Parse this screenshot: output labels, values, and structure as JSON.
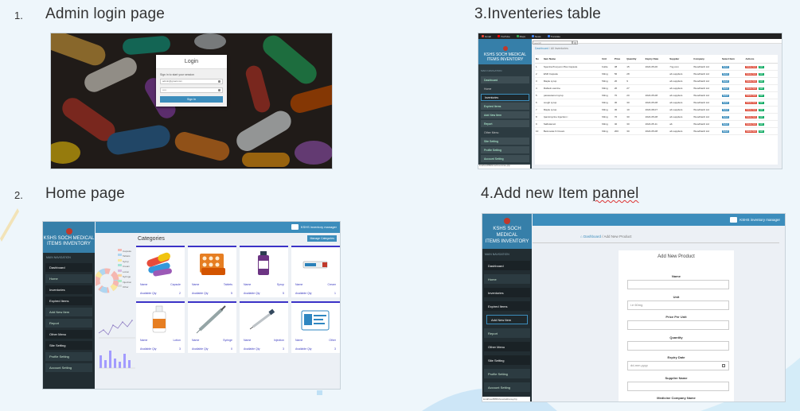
{
  "sections": {
    "login": {
      "num": "1.",
      "title": "Admin login page"
    },
    "inventory": {
      "title": "3.Inventeries table"
    },
    "home": {
      "num": "2.",
      "title": "Home page"
    },
    "add_item": {
      "title_prefix": "4.Add new Item ",
      "title_misspelled": "pannel"
    }
  },
  "login_screen": {
    "header": "Login",
    "hint": "Sign in to start your session",
    "email_value": "admin@gmail.com",
    "password_value": "•••••",
    "submit_label": "Sign In"
  },
  "inventory_screen": {
    "bookmarks": [
      "Gmail",
      "YouTube",
      "Maps",
      "News",
      "Translate"
    ],
    "search_placeholder": "search",
    "search_button": "Q",
    "app_name_line1": "KSHS SOCH MEDICAL",
    "app_name_line2": "ITEMS INVENTORY",
    "nav_header": "MAIN NAVIGATION",
    "nav": [
      "Dashboard",
      "Home",
      "Inventories",
      "Expired Items",
      "Add New Item",
      "Report",
      "Other Menu",
      "Site Setting",
      "Profile Setting",
      "Account Setting"
    ],
    "breadcrumb_root": "Dashboard",
    "breadcrumb_current": "All Inventories",
    "columns": [
      "No",
      "Item Name",
      "Unit",
      "Price",
      "Quantity",
      "Expiry Date",
      "Supplier",
      "Company",
      "Select Item",
      "Actions"
    ],
    "rows": [
      [
        "1",
        "Spectra-Proxyvon Plus Capsule",
        "bottle",
        "38",
        "15",
        "2024-05-00",
        "7ng.com",
        "Woodhardt Ltd"
      ],
      [
        "2",
        "ESR Capsule",
        "60mg",
        "56",
        "28",
        "",
        "ab suppliers",
        "Woodhardt Ltd"
      ],
      [
        "3",
        "Maple syrup",
        "50mg",
        "20",
        "9",
        "",
        "ab suppliers",
        "Woodhardt Ltd"
      ],
      [
        "4",
        "Rabiels vaccine",
        "60mg",
        "20",
        "27",
        "",
        "ab suppliers",
        "Woodhardt Ltd"
      ],
      [
        "5",
        "paracetamol syrup",
        "60mg",
        "70",
        "20",
        "2024-05-08",
        "ab suppliers",
        "Woodhardt Ltd"
      ],
      [
        "6",
        "cough syrup",
        "60mg",
        "30",
        "30",
        "2024-05-08",
        "ab suppliers",
        "Woodhardt Ltd"
      ],
      [
        "7",
        "Maple syrup",
        "60mg",
        "30",
        "10",
        "2024-08-07",
        "ab suppliers",
        "Woodhardt Ltd"
      ],
      [
        "8",
        "Ipamimycine Injection i",
        "60mg",
        "70",
        "30",
        "2024-05-08",
        "ab suppliers",
        "Woodhardt Ltd"
      ],
      [
        "9",
        "Salbutamol",
        "60mg",
        "40",
        "30",
        "2024-05-11",
        "ab",
        "Woodhardt Ltd"
      ],
      [
        "10",
        "Betnovate N Cream",
        "60mg",
        "200",
        "30",
        "2024-05-08",
        "ab suppliers",
        "Woodhardt Ltd"
      ]
    ],
    "select_label": "Select",
    "delete_label": "Delete Item",
    "edit_label": "Edit",
    "status_url": "localhost/888/show/inventories.php"
  },
  "home_screen": {
    "app_name_line1": "KSHS SOCH MEDICAL",
    "app_name_line2": "ITEMS INVENTORY",
    "topbar_user": "KSHS inventory manager",
    "nav_header": "MAIN NAVIGATION",
    "nav": [
      "Dashboard",
      "Home",
      "Inventories",
      "Expired Items",
      "Add New Item",
      "Report",
      "Other Menu",
      "Site Setting",
      "Profile Setting",
      "Account Setting"
    ],
    "categories_title": "Categories",
    "manage_button": "Manage Categories",
    "legend": [
      "Capsule",
      "Tablets",
      "Syrup",
      "Cream",
      "Lotion",
      "Syringe",
      "Injection",
      "Other"
    ],
    "name_label": "Name",
    "qty_label": "Available Qty",
    "cards": [
      {
        "name": "Capsule",
        "qty": "2",
        "icon": "capsule-icon"
      },
      {
        "name": "Tablets",
        "qty": "5",
        "icon": "tablets-icon"
      },
      {
        "name": "Syrup",
        "qty": "5",
        "icon": "syrup-icon"
      },
      {
        "name": "Cream",
        "qty": "1",
        "icon": "cream-icon"
      },
      {
        "name": "Lotion",
        "qty": "3",
        "icon": "lotion-icon"
      },
      {
        "name": "Syringe",
        "qty": "0",
        "icon": "syringe-icon"
      },
      {
        "name": "Injection",
        "qty": "3",
        "icon": "injection-icon"
      },
      {
        "name": "Other",
        "qty": "3",
        "icon": "other-icon"
      }
    ]
  },
  "add_screen": {
    "app_name_line1": "KSHS SOCH MEDICAL",
    "app_name_line2": "ITEMS INVENTORY",
    "topbar_user": "KSHS inventory manager",
    "nav_header": "MAIN NAVIGATION",
    "nav": [
      "Dashboard",
      "Home",
      "Inventories",
      "Expired Items",
      "Add New Item",
      "Report",
      "Other Menu",
      "Site Setting",
      "Profile Setting",
      "Account Setting"
    ],
    "breadcrumb_root": "Dashboard",
    "breadcrumb_current": "Add New Product",
    "form_title": "Add New Product",
    "fields": [
      {
        "label": "Name",
        "value": ""
      },
      {
        "label": "Unit",
        "value": "i.e 60mg"
      },
      {
        "label": "Price Per Unit",
        "value": ""
      },
      {
        "label": "Quantity",
        "value": ""
      },
      {
        "label": "Expiry Date",
        "value": "dd-mm-yyyy"
      },
      {
        "label": "Supplier Name",
        "value": ""
      },
      {
        "label": "Medicine Company Name",
        "value": ""
      }
    ],
    "status_url": "localhost/888/show/addnew.php"
  },
  "colors": {
    "sidebar": "#222d32",
    "topbar": "#3c8dbc",
    "logo_blue": "#367fa9",
    "card_border": "#3b32c7",
    "delete_red": "#dd4b39",
    "edit_green": "#00a65a"
  }
}
